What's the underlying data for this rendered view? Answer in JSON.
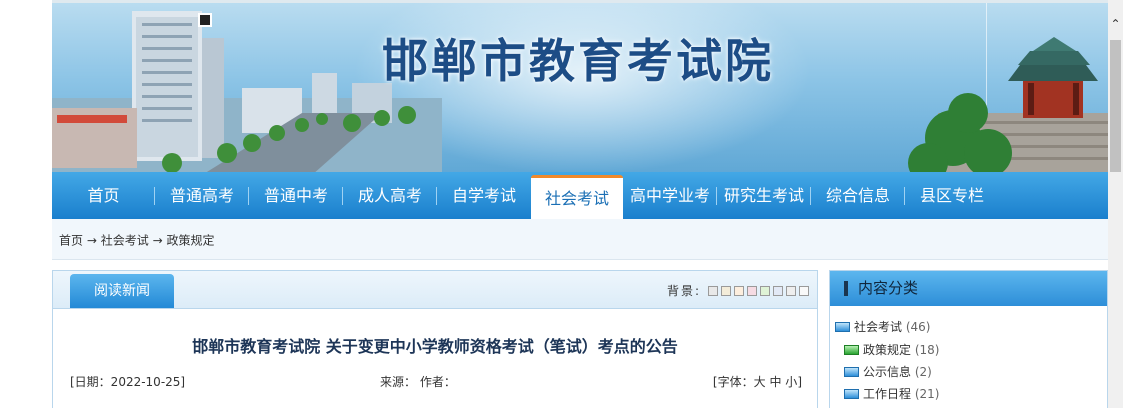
{
  "banner": {
    "title": "邯郸市教育考试院"
  },
  "nav": {
    "items": [
      {
        "label": "首页",
        "active": false
      },
      {
        "label": "普通高考",
        "active": false
      },
      {
        "label": "普通中考",
        "active": false
      },
      {
        "label": "成人高考",
        "active": false
      },
      {
        "label": "自学考试",
        "active": false
      },
      {
        "label": "社会考试",
        "active": true
      },
      {
        "label": "高中学业考",
        "active": false
      },
      {
        "label": "研究生考试",
        "active": false
      },
      {
        "label": "综合信息",
        "active": false
      },
      {
        "label": "县区专栏",
        "active": false
      }
    ]
  },
  "breadcrumb": {
    "home": "首页",
    "arrow": "→",
    "level1": "社会考试",
    "level2": "政策规定"
  },
  "article": {
    "tab_label": "阅读新闻",
    "bg_label": "背景:",
    "swatch_colors": [
      "#e8e8e8",
      "#f3ecd9",
      "#fdeede",
      "#f6dbe3",
      "#dff3d6",
      "#e2e9f6",
      "#eeeeee",
      "#f9f9f9"
    ],
    "title": "邯郸市教育考试院 关于变更中小学教师资格考试（笔试）考点的公告",
    "date": "[日期：2022-10-25]",
    "source": "来源：  作者：",
    "font_prefix": "[字体：",
    "font_large": "大",
    "font_medium": "中",
    "font_small": "小",
    "font_suffix": "]"
  },
  "sidebar": {
    "title": "内容分类",
    "categories": [
      {
        "label": "社会考试",
        "count": "(46)",
        "icon": "folder-blue-icon",
        "level": 0
      },
      {
        "label": "政策规定",
        "count": "(18)",
        "icon": "folder-green-icon",
        "level": 1
      },
      {
        "label": "公示信息",
        "count": "(2)",
        "icon": "folder-blue-icon",
        "level": 1
      },
      {
        "label": "工作日程",
        "count": "(21)",
        "icon": "folder-blue-icon",
        "level": 1
      }
    ]
  }
}
